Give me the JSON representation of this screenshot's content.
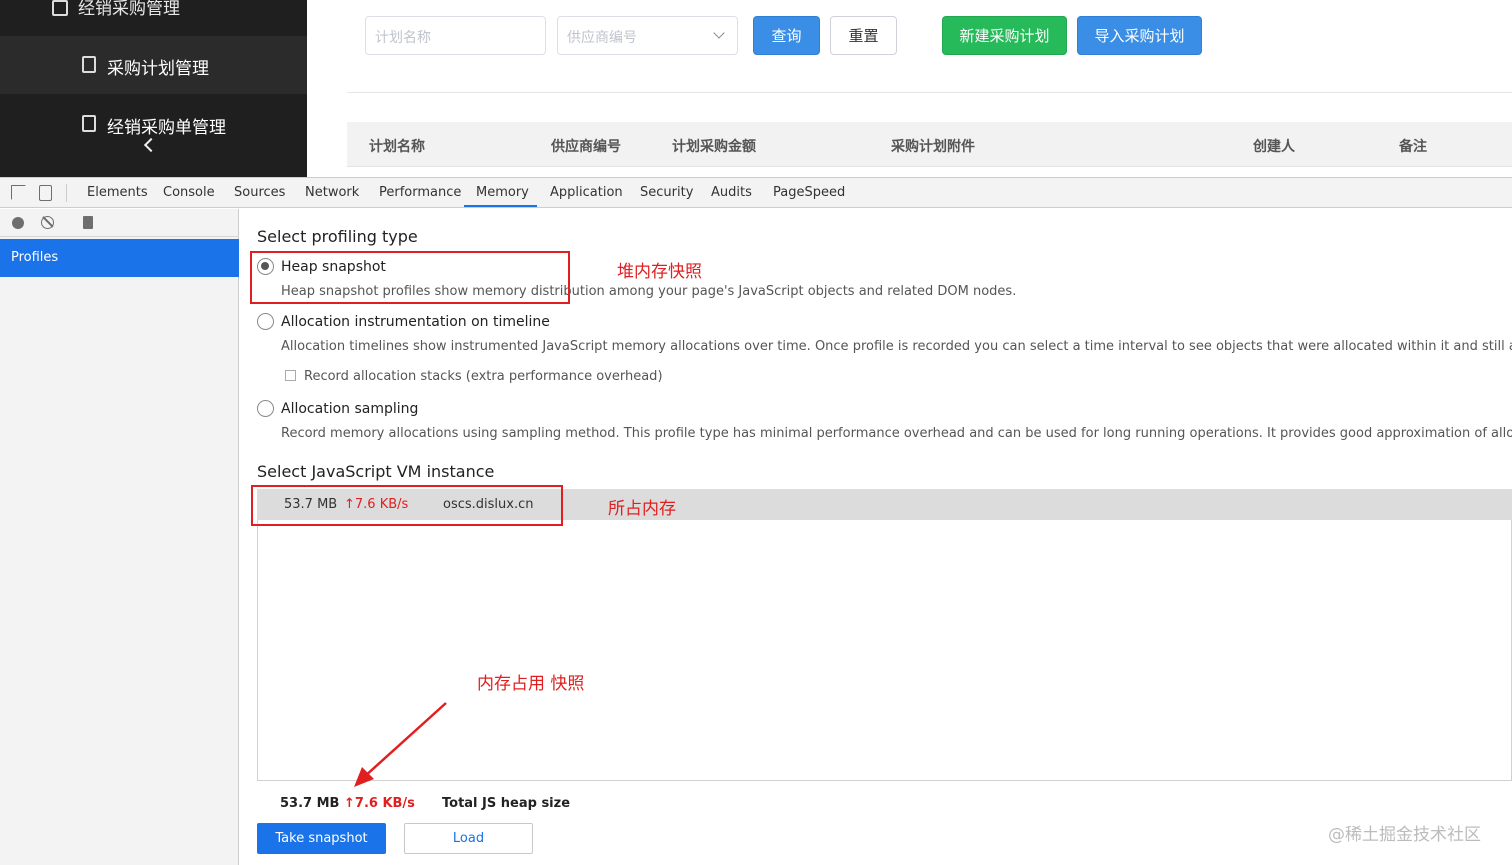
{
  "app": {
    "sidebar": {
      "group_label": "经销采购管理",
      "items": [
        {
          "label": "采购计划管理",
          "active": true
        },
        {
          "label": "经销采购单管理",
          "active": false
        }
      ]
    },
    "filters": {
      "plan_name_placeholder": "计划名称",
      "supplier_placeholder": "供应商编号"
    },
    "buttons": {
      "query": "查询",
      "reset": "重置",
      "new_plan": "新建采购计划",
      "import_plan": "导入采购计划"
    },
    "table": {
      "columns": [
        "计划名称",
        "供应商编号",
        "计划采购金额",
        "采购计划附件",
        "创建人",
        "备注"
      ]
    }
  },
  "devtools": {
    "tabs": [
      "Elements",
      "Console",
      "Sources",
      "Network",
      "Performance",
      "Memory",
      "Application",
      "Security",
      "Audits",
      "PageSpeed"
    ],
    "active_tab": "Memory",
    "left_panel": {
      "selected_item": "Profiles"
    },
    "profiling": {
      "title": "Select profiling type",
      "options": [
        {
          "label": "Heap snapshot",
          "description": "Heap snapshot profiles show memory distribution among your page's JavaScript objects and related DOM nodes.",
          "selected": true
        },
        {
          "label": "Allocation instrumentation on timeline",
          "description": "Allocation timelines show instrumented JavaScript memory allocations over time. Once profile is recorded you can select a time interval to see objects that were allocated within it and still alive by the end of recording",
          "checkbox_label": "Record allocation stacks (extra performance overhead)",
          "selected": false
        },
        {
          "label": "Allocation sampling",
          "description": "Record memory allocations using sampling method. This profile type has minimal performance overhead and can be used for long running operations. It provides good approximation of allocations broken down by Ja",
          "selected": false
        }
      ]
    },
    "vm": {
      "title": "Select JavaScript VM instance",
      "instance": {
        "size": "53.7 MB",
        "rate": "↑7.6 KB/s",
        "host": "oscs.dislux.cn"
      }
    },
    "footer": {
      "size": "53.7 MB",
      "rate": "↑7.6 KB/s",
      "label": "Total JS heap size",
      "take_snapshot": "Take snapshot",
      "load": "Load"
    }
  },
  "annotations": {
    "heap_snapshot": "堆内存快照",
    "memory_usage": "所占内存",
    "snapshot_note": "内存占用 快照"
  },
  "watermark": "@稀土掘金技术社区",
  "colors": {
    "accent": "#1a73e8",
    "annotation": "#e02020",
    "green_button": "#27ba5a",
    "blue_button": "#3a8ee6"
  }
}
